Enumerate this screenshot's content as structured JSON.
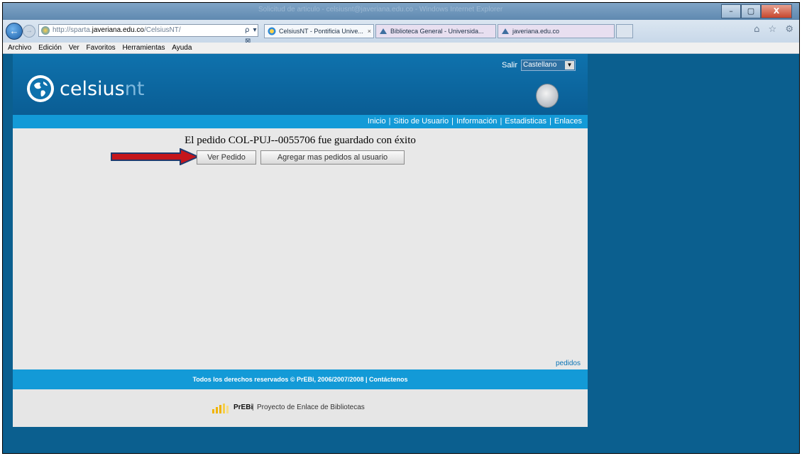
{
  "browser": {
    "title_bar_text": "Solicitud de articulo - celsiusnt@javeriana.edu.co - Windows Internet Explorer",
    "address": {
      "prefix": "http://sparta.",
      "domain": "javeriana.edu.co",
      "path": "/CelsiusNT/"
    },
    "address_tools": "ρ ▾ ⊠ C ✕",
    "tabs": [
      {
        "label": "CelsiusNT - Pontificia Unive...",
        "close": "×"
      },
      {
        "label": "Biblioteca General - Universida..."
      },
      {
        "label": "javeriana.edu.co"
      }
    ],
    "right_icons": "⌂ ☆ ⚙",
    "window_buttons": [
      "–",
      "▢",
      "X"
    ],
    "menu": [
      "Archivo",
      "Edición",
      "Ver",
      "Favoritos",
      "Herramientas",
      "Ayuda"
    ]
  },
  "header": {
    "logo_main": "celsius",
    "logo_suffix": "nt",
    "salir": "Salir",
    "language": "Castellano"
  },
  "nav": {
    "items": [
      "Inicio",
      "Sitio de Usuario",
      "Información",
      "Estadisticas",
      "Enlaces"
    ],
    "separator": "|"
  },
  "content": {
    "message": "El pedido COL-PUJ--0055706 fue guardado con éxito",
    "buttons": {
      "view": "Ver Pedido",
      "add_more": "Agregar mas pedidos al usuario"
    },
    "pedidos_link": "pedidos"
  },
  "footer": {
    "copyright": "Todos los derechos reservados © PrEBi, 2006/2007/2008 | Contáctenos",
    "prebi_name": "PrEBi",
    "prebi_sep": "|",
    "prebi_desc": "Proyecto de Enlace de Bibliotecas"
  },
  "colors": {
    "header_blue": "#0f72ad",
    "nav_blue": "#139ad7",
    "arrow_red": "#c5161c",
    "arrow_border": "#1f3a6e"
  }
}
